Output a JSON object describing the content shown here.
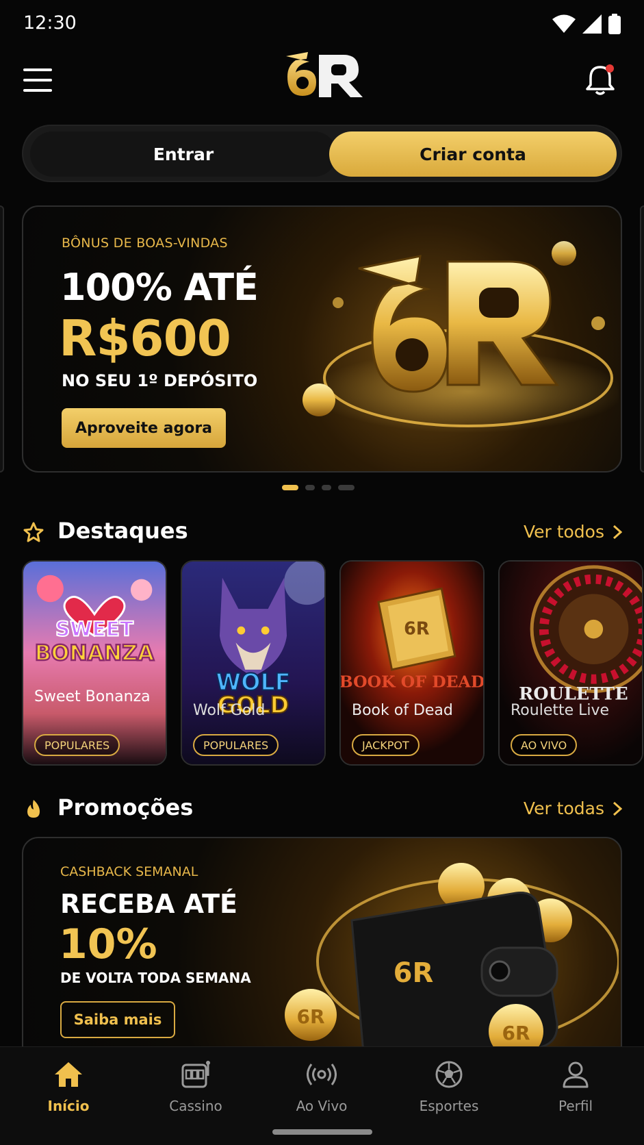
{
  "status_bar": {
    "time": "12:30"
  },
  "header": {
    "logo_text": "6R",
    "notification_dot_color": "#e53935"
  },
  "auth": {
    "login_label": "Entrar",
    "signup_label": "Criar conta"
  },
  "hero": {
    "eyebrow": "BÔNUS DE BOAS-VINDAS",
    "line1": "100% ATÉ",
    "line2": "R$600",
    "line3": "NO SEU 1º DEPÓSITO",
    "cta": "Aproveite agora",
    "carousel_slide_count": 4,
    "carousel_active_index": 0
  },
  "highlights": {
    "title": "Destaques",
    "more_label": "Ver todos",
    "games": [
      {
        "name": "Sweet Bonanza",
        "tag": "POPULARES",
        "art_text": "SWEET BONANZA"
      },
      {
        "name": "Wolf Gold",
        "tag": "POPULARES",
        "art_text": "WOLF GOLD"
      },
      {
        "name": "Book of Dead",
        "tag": "JACKPOT",
        "art_text": "BOOK OF DEAD"
      },
      {
        "name": "Roulette Live",
        "tag": "AO VIVO",
        "art_text": "ROULETTE LIVE"
      }
    ]
  },
  "promotions": {
    "title": "Promoções",
    "more_label": "Ver todas",
    "card": {
      "eyebrow": "CASHBACK SEMANAL",
      "line1": "RECEBA ATÉ",
      "line2": "10%",
      "line3": "DE VOLTA TODA SEMANA",
      "cta": "Saiba mais"
    }
  },
  "bottom_nav": {
    "items": [
      {
        "label": "Início",
        "icon": "home-icon",
        "active": true
      },
      {
        "label": "Cassino",
        "icon": "slot-machine-icon",
        "active": false
      },
      {
        "label": "Ao Vivo",
        "icon": "live-icon",
        "active": false
      },
      {
        "label": "Esportes",
        "icon": "soccer-ball-icon",
        "active": false
      },
      {
        "label": "Perfil",
        "icon": "person-icon",
        "active": false
      }
    ]
  },
  "colors": {
    "accent": "#f0c04e",
    "background": "#060606",
    "inactive": "#9b9b9b"
  }
}
